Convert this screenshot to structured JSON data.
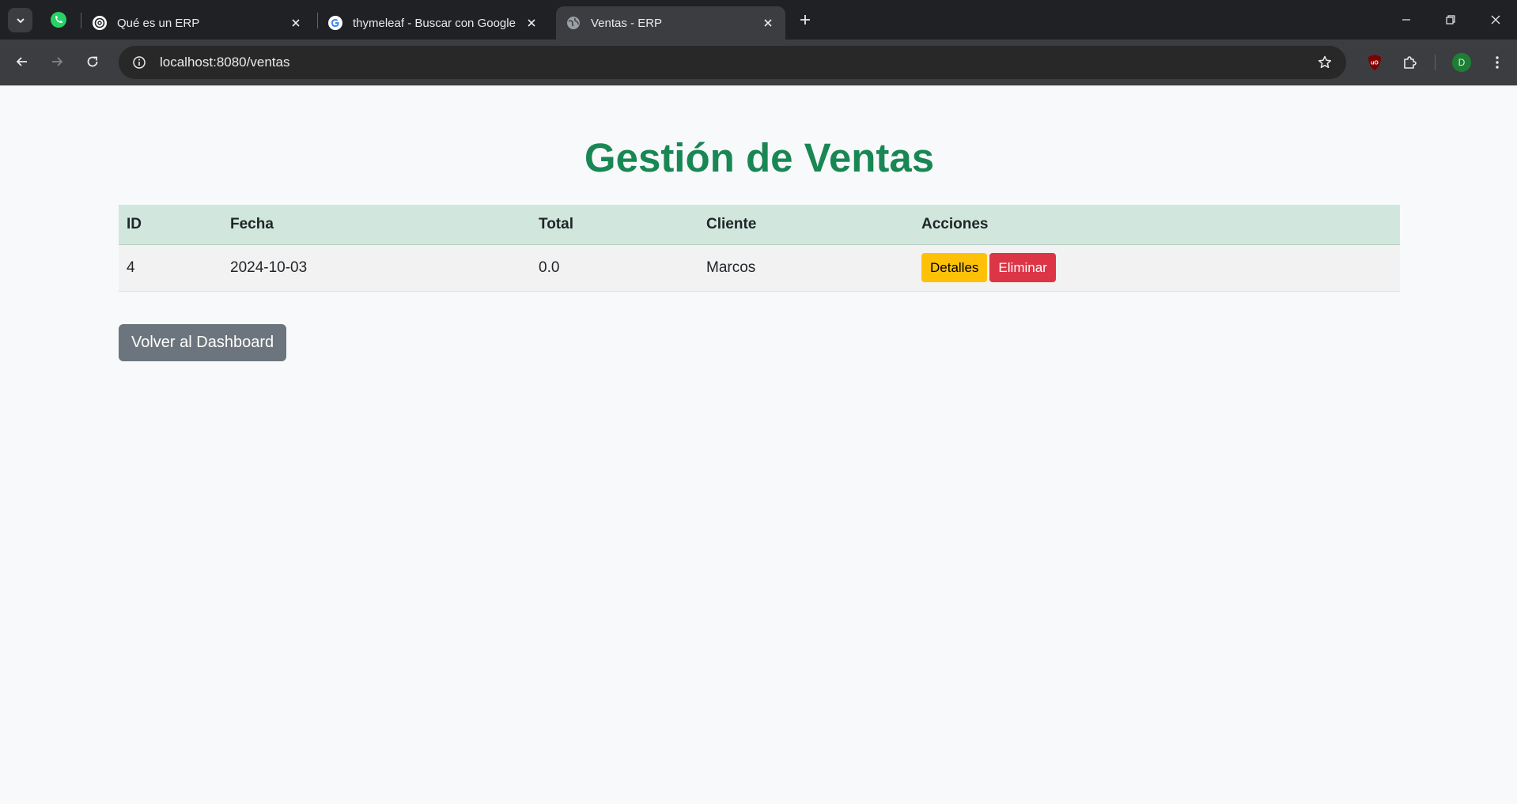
{
  "browser": {
    "tabs": [
      {
        "title": "Qué es un ERP",
        "icon": "openai-icon",
        "active": false
      },
      {
        "title": "thymeleaf - Buscar con Google",
        "icon": "google-icon",
        "active": false
      },
      {
        "title": "Ventas - ERP",
        "icon": "globe-icon",
        "active": true
      }
    ],
    "url": "localhost:8080/ventas",
    "profile_initial": "D"
  },
  "page": {
    "title": "Gestión de Ventas",
    "table": {
      "headers": {
        "id": "ID",
        "fecha": "Fecha",
        "total": "Total",
        "cliente": "Cliente",
        "acciones": "Acciones"
      },
      "rows": [
        {
          "id": "4",
          "fecha": "2024-10-03",
          "total": "0.0",
          "cliente": "Marcos",
          "details_label": "Detalles",
          "delete_label": "Eliminar"
        }
      ]
    },
    "back_button": "Volver al Dashboard"
  },
  "colors": {
    "title": "#198754",
    "header_row": "#d1e7dd",
    "warning": "#ffc107",
    "danger": "#dc3545",
    "secondary": "#6c757d"
  }
}
